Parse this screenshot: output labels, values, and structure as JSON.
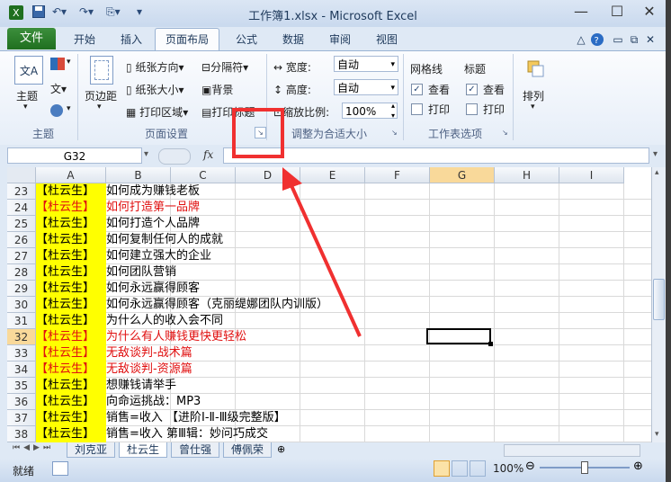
{
  "window": {
    "title": "工作簿1.xlsx - Microsoft Excel"
  },
  "tabs": {
    "file": "文件",
    "items": [
      "开始",
      "插入",
      "页面布局",
      "公式",
      "数据",
      "审阅",
      "视图"
    ],
    "active": "页面布局"
  },
  "ribbon": {
    "themes": {
      "theme_label": "主题",
      "group_label": "主题",
      "abbr": "文A"
    },
    "page_setup": {
      "margins": "页边距",
      "orientation": "纸张方向",
      "size": "纸张大小",
      "print_area": "打印区域",
      "breaks": "分隔符",
      "background": "背景",
      "print_titles": "打印标题",
      "group_label": "页面设置"
    },
    "scale": {
      "width_label": "宽度:",
      "width_value": "自动",
      "height_label": "高度:",
      "height_value": "自动",
      "scale_label": "缩放比例:",
      "scale_value": "100%",
      "group_label": "调整为合适大小"
    },
    "sheet_options": {
      "gridlines": "网格线",
      "headings": "标题",
      "view": "查看",
      "print": "打印",
      "group_label": "工作表选项"
    },
    "arrange": {
      "label": "排列"
    }
  },
  "formula_bar": {
    "name_box": "G32",
    "fx": "fx"
  },
  "columns": [
    "A",
    "B",
    "C",
    "D",
    "E",
    "F",
    "G",
    "H",
    "I"
  ],
  "selected_column": "G",
  "selected_row": "32",
  "rows": [
    {
      "num": "23",
      "a": "【杜云生】",
      "b": "如何成为赚钱老板",
      "red": false
    },
    {
      "num": "24",
      "a": "【杜云生】",
      "b": "如何打造第一品牌",
      "red": true
    },
    {
      "num": "25",
      "a": "【杜云生】",
      "b": "如何打造个人品牌",
      "red": false
    },
    {
      "num": "26",
      "a": "【杜云生】",
      "b": "如何复制任何人的成就",
      "red": false
    },
    {
      "num": "27",
      "a": "【杜云生】",
      "b": "如何建立强大的企业",
      "red": false
    },
    {
      "num": "28",
      "a": "【杜云生】",
      "b": "如何团队营销",
      "red": false
    },
    {
      "num": "29",
      "a": "【杜云生】",
      "b": "如何永远赢得顾客",
      "red": false
    },
    {
      "num": "30",
      "a": "【杜云生】",
      "b": "如何永远赢得顾客（克丽缇娜团队内训版）",
      "red": false
    },
    {
      "num": "31",
      "a": "【杜云生】",
      "b": "为什么人的收入会不同",
      "red": false
    },
    {
      "num": "32",
      "a": "【杜云生】",
      "b": "为什么有人赚钱更快更轻松",
      "red": true
    },
    {
      "num": "33",
      "a": "【杜云生】",
      "b": "无敌谈判-战术篇",
      "red": true
    },
    {
      "num": "34",
      "a": "【杜云生】",
      "b": "无敌谈判-资源篇",
      "red": true
    },
    {
      "num": "35",
      "a": "【杜云生】",
      "b": "想赚钱请举手",
      "red": false
    },
    {
      "num": "36",
      "a": "【杜云生】",
      "b": "向命运挑战：MP3",
      "red": false
    },
    {
      "num": "37",
      "a": "【杜云生】",
      "b": "销售=收入 【进阶Ⅰ-Ⅱ-Ⅲ级完整版】",
      "red": false
    },
    {
      "num": "38",
      "a": "【杜云生】",
      "b": "销售=收入 第Ⅲ辑：妙问巧成交",
      "red": false
    }
  ],
  "sheet_tabs": [
    "刘克亚",
    "杜云生",
    "曾仕强",
    "傅佩荣"
  ],
  "status": {
    "ready": "就绪",
    "zoom": "100%"
  },
  "colors": {
    "accent_red": "#e01010",
    "highlight_yellow": "#ffff00",
    "file_green": "#2a7d2a"
  }
}
